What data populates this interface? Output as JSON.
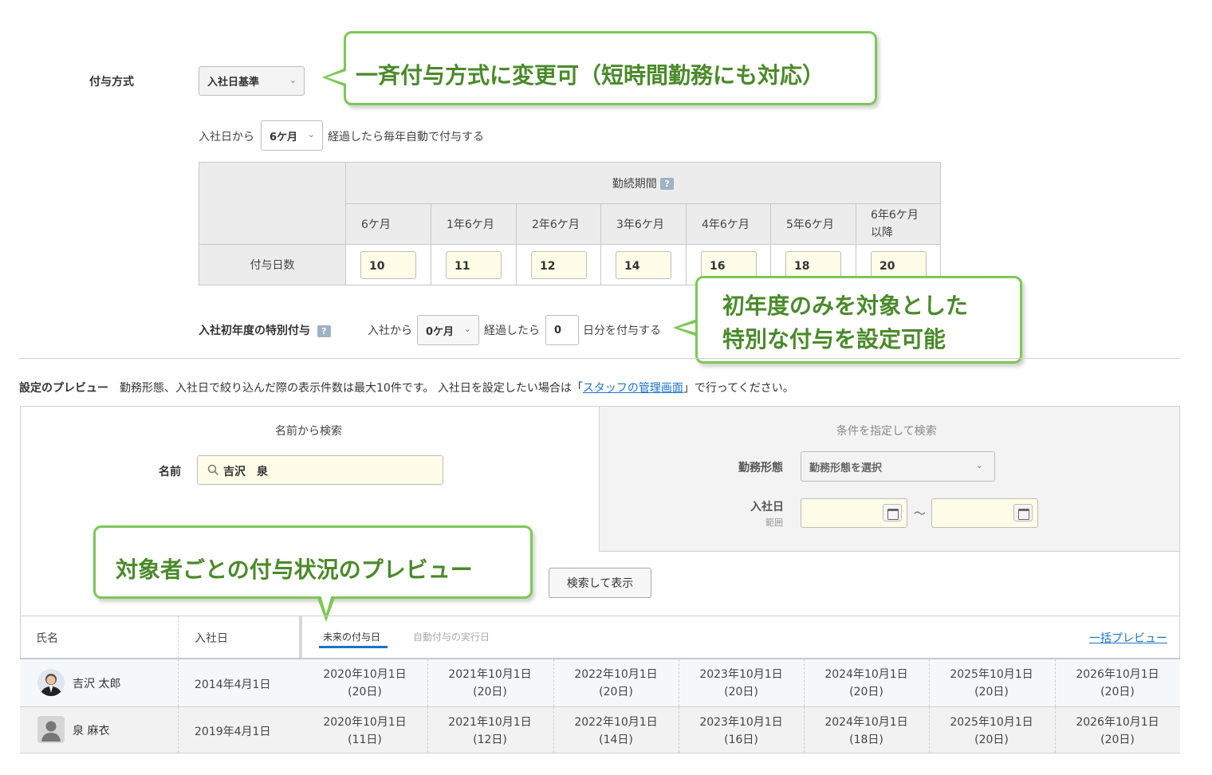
{
  "grant": {
    "method_label": "付与方式",
    "method_value": "入社日基準",
    "auto_prefix": "入社日から",
    "auto_months": "6ケ月",
    "auto_suffix": "経過したら毎年自動で付与する"
  },
  "tenure_table": {
    "header": "勤続期間",
    "row_label": "付与日数",
    "columns": [
      {
        "period": "6ケ月",
        "days": "10"
      },
      {
        "period": "1年6ケ月",
        "days": "11"
      },
      {
        "period": "2年6ケ月",
        "days": "12"
      },
      {
        "period": "3年6ケ月",
        "days": "14"
      },
      {
        "period": "4年6ケ月",
        "days": "16"
      },
      {
        "period": "5年6ケ月",
        "days": "18"
      },
      {
        "period": "6年6ケ月以降",
        "days": "20"
      }
    ]
  },
  "special": {
    "label": "入社初年度の特別付与",
    "prefix": "入社から",
    "months": "0ケ月",
    "middle": "経過したら",
    "days": "0",
    "suffix": "日分を付与する"
  },
  "callouts": {
    "top": "一斉付与方式に変更可（短時間勤務にも対応）",
    "special_line1": "初年度のみを対象とした",
    "special_line2": "特別な付与を設定可能",
    "preview": "対象者ごとの付与状況のプレビュー"
  },
  "preview": {
    "title": "設定のプレビュー",
    "desc_before": "勤務形態、入社日で絞り込んだ際の表示件数は最大10件です。 入社日を設定したい場合は「",
    "desc_link": "スタッフの管理画面",
    "desc_after": "」で行ってください。",
    "name_search_title": "名前から検索",
    "name_label": "名前",
    "name_value": "吉沢　泉",
    "cond_search_title": "条件を指定して検索",
    "work_type_label": "勤務形態",
    "work_type_placeholder": "勤務形態を選択",
    "join_date_label": "入社日",
    "join_date_sub": "範囲",
    "range_sep": "～",
    "search_button": "検索して表示"
  },
  "list": {
    "col_name": "氏名",
    "col_join": "入社日",
    "tab_future": "未来の付与日",
    "tab_auto": "自動付与の実行日",
    "bulk_preview": "一括プレビュー",
    "staff": [
      {
        "name": "吉沢 太郎",
        "join": "2014年4月1日",
        "grants": [
          {
            "date": "2020年10月1日",
            "days": "(20日)"
          },
          {
            "date": "2021年10月1日",
            "days": "(20日)"
          },
          {
            "date": "2022年10月1日",
            "days": "(20日)"
          },
          {
            "date": "2023年10月1日",
            "days": "(20日)"
          },
          {
            "date": "2024年10月1日",
            "days": "(20日)"
          },
          {
            "date": "2025年10月1日",
            "days": "(20日)"
          },
          {
            "date": "2026年10月1日",
            "days": "(20日)"
          }
        ]
      },
      {
        "name": "泉 麻衣",
        "join": "2019年4月1日",
        "grants": [
          {
            "date": "2020年10月1日",
            "days": "(11日)"
          },
          {
            "date": "2021年10月1日",
            "days": "(12日)"
          },
          {
            "date": "2022年10月1日",
            "days": "(14日)"
          },
          {
            "date": "2023年10月1日",
            "days": "(16日)"
          },
          {
            "date": "2024年10月1日",
            "days": "(18日)"
          },
          {
            "date": "2025年10月1日",
            "days": "(20日)"
          },
          {
            "date": "2026年10月1日",
            "days": "(20日)"
          }
        ]
      }
    ]
  },
  "colors": {
    "callout_border": "#7cc855",
    "callout_text": "#4a8a2a",
    "link": "#1a73c9",
    "input_bg": "#fffde7"
  }
}
